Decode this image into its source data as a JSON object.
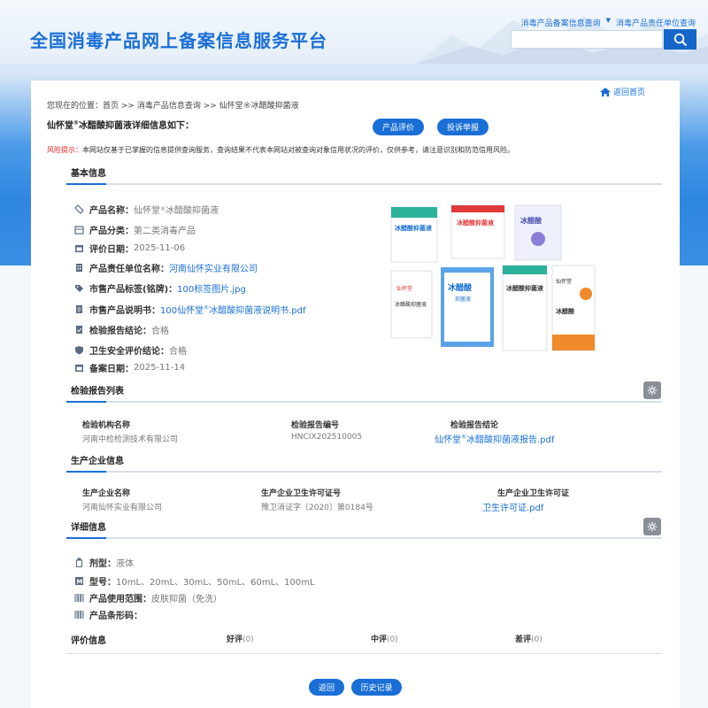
{
  "header": {
    "site_title": "全国消毒产品网上备案信息服务平台",
    "nav_query": "消毒产品备案信息查询",
    "nav_company": "消毒产品责任单位查询",
    "search_placeholder": ""
  },
  "breadcrumb": {
    "prefix": "您现在的位置：",
    "items": [
      "首页",
      "消毒产品信息查询",
      "仙怀堂®冰醋酸抑菌液"
    ],
    "sep": " >> "
  },
  "back_home": "返回首页",
  "detail": {
    "name_main": "仙怀堂",
    "name_mark": "®",
    "name_rest": "冰醋酸抑菌液详细信息如下：",
    "btn_eval": "产品评价",
    "btn_report": "投诉举报"
  },
  "risk": {
    "label": "风险提示：",
    "text": "本网站仅基于已掌握的信息提供查询服务，查询结果不代表本网站对被查询对象信用状况的评价，仅供参考，请注意识别和防范信用风险。"
  },
  "basic": {
    "heading": "基本信息",
    "rows": [
      {
        "label": "产品名称：",
        "value": "仙怀堂",
        "mark": "®",
        "value_rest": "冰醋酸抑菌液"
      },
      {
        "label": "产品分类：",
        "value": "第二类消毒产品"
      },
      {
        "label": "评价日期：",
        "value": "2025-11-06"
      },
      {
        "label": "产品责任单位名称：",
        "value": "河南仙怀实业有限公司"
      },
      {
        "label": "市售产品标签(铭牌)：",
        "value": "100标签图片.jpg"
      },
      {
        "label": "市售产品说明书：",
        "value": "100仙怀堂",
        "mark": "®",
        "value_rest": "冰醋酸抑菌液说明书.pdf"
      },
      {
        "label": "检验报告结论：",
        "value": "合格"
      },
      {
        "label": "卫生安全评价结论：",
        "value": "合格"
      },
      {
        "label": "备案日期：",
        "value": "2025-11-14"
      }
    ]
  },
  "reports": {
    "heading": "检验报告列表",
    "columns": [
      "检验机构名称",
      "检验报告编号",
      "检验报告结论"
    ],
    "row": {
      "org": "河南中检检测技术有限公司",
      "no": "HNCIX202510005",
      "file": "仙怀堂",
      "mark": "®",
      "file_rest": "冰醋酸抑菌液报告.pdf"
    }
  },
  "company": {
    "heading": "生产企业信息",
    "columns": [
      "生产企业名称",
      "生产企业卫生许可证号",
      "生产企业卫生许可证"
    ],
    "row": {
      "name": "河南仙怀实业有限公司",
      "license_no": "豫卫消证字〔2020〕第0184号",
      "license_file": "卫生许可证.pdf"
    }
  },
  "details": {
    "heading": "详细信息",
    "rows": [
      {
        "label": "剂型：",
        "value": "液体"
      },
      {
        "label": "型号：",
        "value": "10mL、20mL、30mL、50mL、60mL、100mL"
      },
      {
        "label": "产品使用范围：",
        "value": "皮肤抑菌（免洗）"
      },
      {
        "label": "产品条形码：",
        "value": ""
      }
    ]
  },
  "evaluation": {
    "heading": "评价信息",
    "good_label": "好评",
    "good_count": "(0)",
    "mid_label": "中评",
    "mid_count": "(0)",
    "bad_label": "差评",
    "bad_count": "(0)"
  },
  "footer": {
    "back": "返回",
    "history": "历史记录"
  },
  "product_image": {
    "box1": "冰醋酸抑菌液",
    "box2": "冰醋酸抑菌液",
    "box3": "冰醋酸",
    "box4": "冰醋酸抑菌液",
    "box5": "冰醋酸",
    "box5_sub": "抑菌液",
    "box6": "冰醋酸抑菌液",
    "box7": "冰醋酸",
    "brand": "仙怀堂"
  },
  "colors": {
    "brand_blue": "#1a6fd6",
    "risk_red": "#e02020"
  }
}
